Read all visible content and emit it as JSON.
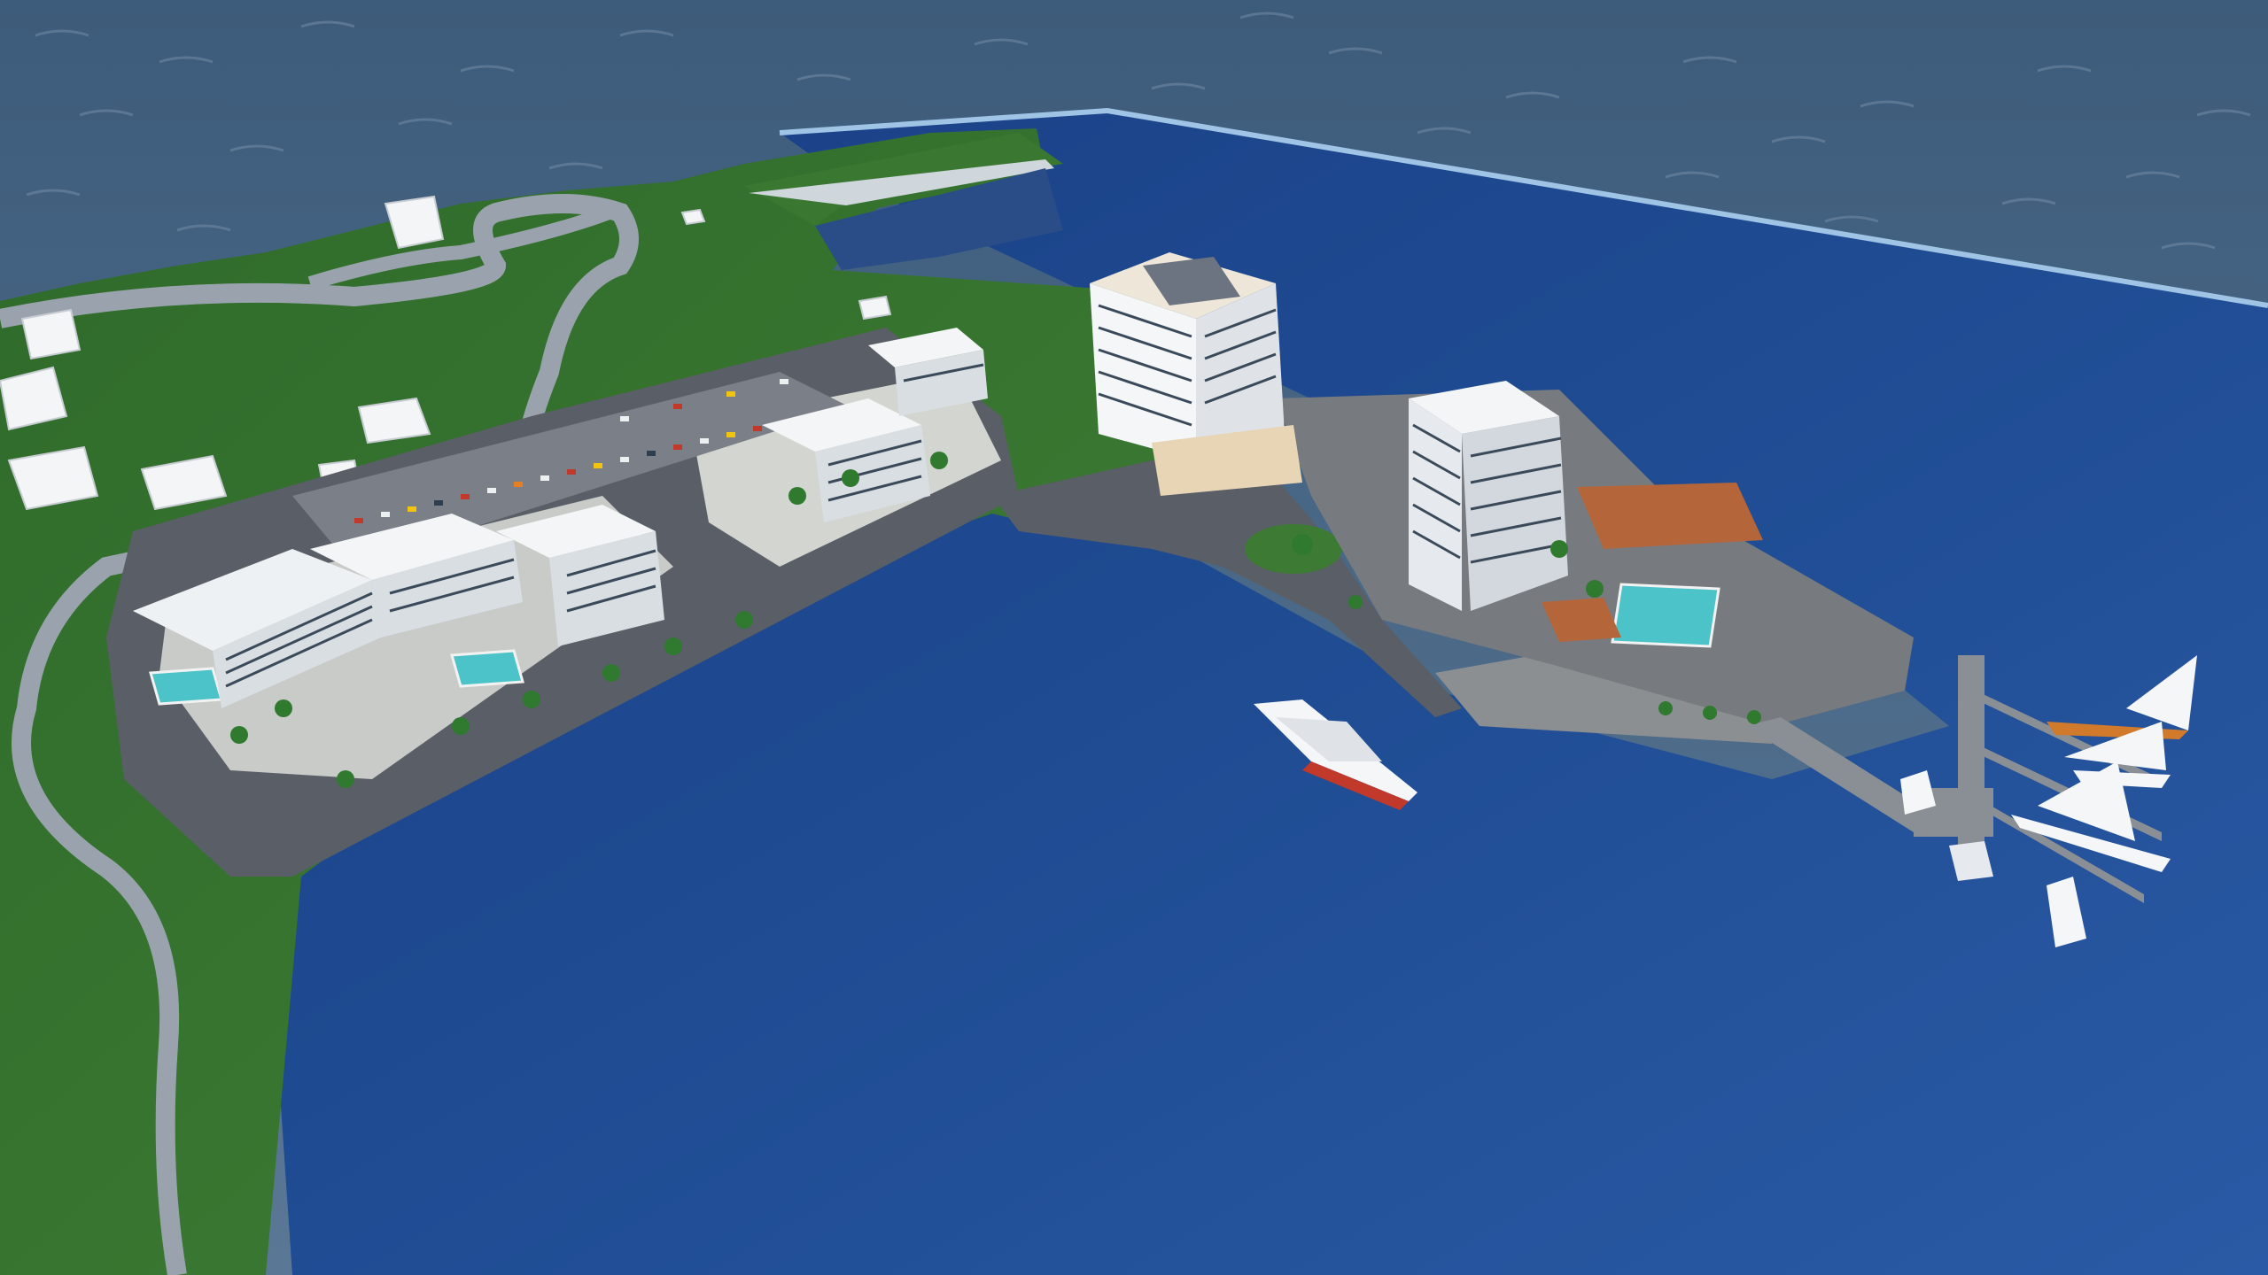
{
  "scene": {
    "subject": "aerial-rendering",
    "colors": {
      "open_sea": "#4a6b8a",
      "harbor_water": "#1f4c93",
      "grass": "#3d7a34",
      "road": "#9aa3ad",
      "plaza": "#5a5e66",
      "building": "#eef1f4",
      "glass": "#3a4a5a",
      "terracotta_roof": "#b5653a",
      "pool": "#4cc3c8",
      "pier": "#8a8f96",
      "boat_hull": "#f4f6f8"
    }
  }
}
